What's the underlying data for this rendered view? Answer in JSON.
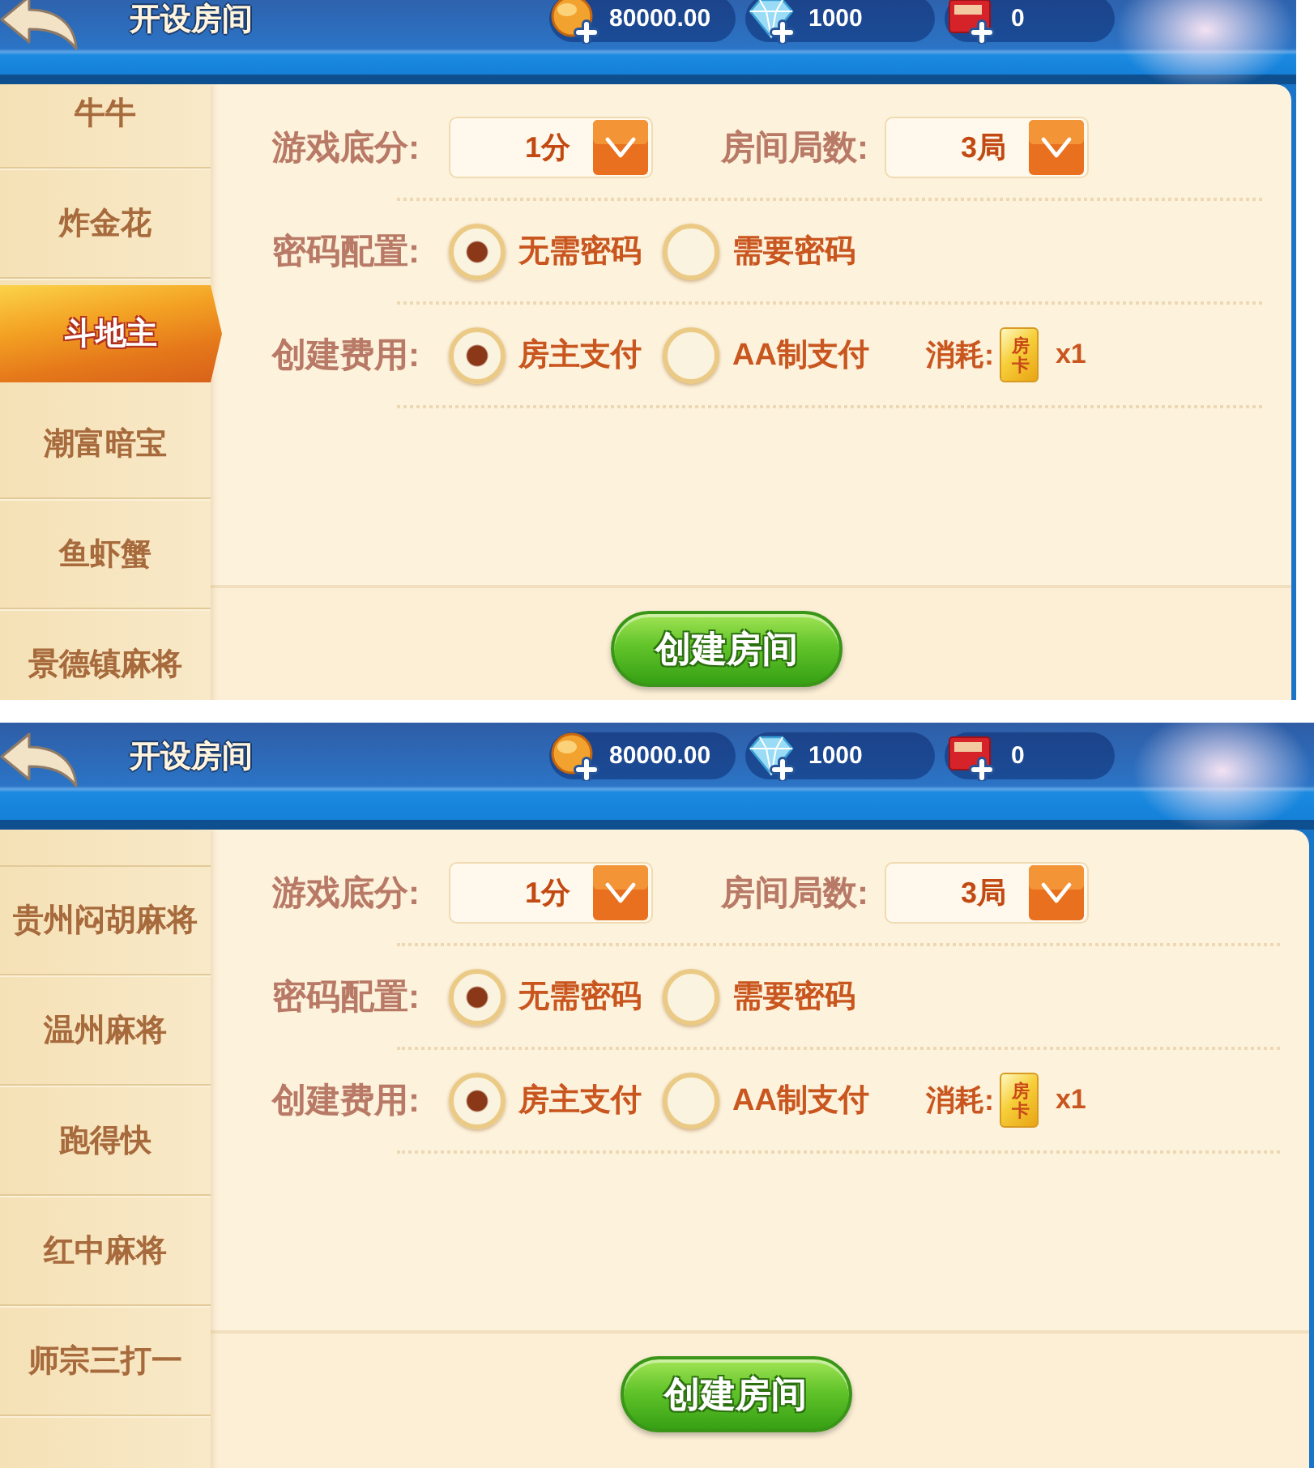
{
  "screens": [
    {
      "header": {
        "title": "开设房间",
        "balances": [
          {
            "kind": "coin",
            "amount": "80000.00"
          },
          {
            "kind": "diamond",
            "amount": "1000"
          },
          {
            "kind": "ticket",
            "amount": "0"
          }
        ]
      },
      "sidebar": {
        "items": [
          {
            "label": "牛牛",
            "selected": false
          },
          {
            "label": "炸金花",
            "selected": false
          },
          {
            "label": "斗地主",
            "selected": true
          },
          {
            "label": "潮富暗宝",
            "selected": false
          },
          {
            "label": "鱼虾蟹",
            "selected": false
          },
          {
            "label": "景德镇麻将",
            "selected": false
          }
        ]
      },
      "settings": [
        {
          "kind": "dropdowns",
          "fields": [
            {
              "label": "游戏底分:",
              "value": "1分"
            },
            {
              "label": "房间局数:",
              "value": "3局"
            }
          ]
        },
        {
          "kind": "radios",
          "label": "密码配置:",
          "options": [
            {
              "label": "无需密码",
              "selected": true
            },
            {
              "label": "需要密码",
              "selected": false
            }
          ]
        },
        {
          "kind": "radios",
          "label": "创建费用:",
          "options": [
            {
              "label": "房主支付",
              "selected": true
            },
            {
              "label": "AA制支付",
              "selected": false
            }
          ],
          "cost": {
            "label": "消耗:",
            "card": "房卡",
            "count": "x1"
          }
        }
      ],
      "create_button": "创建房间"
    },
    {
      "header": {
        "title": "开设房间",
        "balances": [
          {
            "kind": "coin",
            "amount": "80000.00"
          },
          {
            "kind": "diamond",
            "amount": "1000"
          },
          {
            "kind": "ticket",
            "amount": "0"
          }
        ]
      },
      "sidebar": {
        "items": [
          {
            "label": "贵州闷胡麻将",
            "selected": false
          },
          {
            "label": "温州麻将",
            "selected": false
          },
          {
            "label": "跑得快",
            "selected": false
          },
          {
            "label": "红中麻将",
            "selected": false
          },
          {
            "label": "师宗三打一",
            "selected": false
          }
        ]
      },
      "settings": [
        {
          "kind": "dropdowns",
          "fields": [
            {
              "label": "游戏底分:",
              "value": "1分"
            },
            {
              "label": "房间局数:",
              "value": "3局"
            }
          ]
        },
        {
          "kind": "radios",
          "label": "密码配置:",
          "options": [
            {
              "label": "无需密码",
              "selected": true
            },
            {
              "label": "需要密码",
              "selected": false
            }
          ]
        },
        {
          "kind": "radios",
          "label": "创建费用:",
          "options": [
            {
              "label": "房主支付",
              "selected": true
            },
            {
              "label": "AA制支付",
              "selected": false
            }
          ],
          "cost": {
            "label": "消耗:",
            "card": "房卡",
            "count": "x1"
          }
        }
      ],
      "create_button": "创建房间"
    }
  ]
}
